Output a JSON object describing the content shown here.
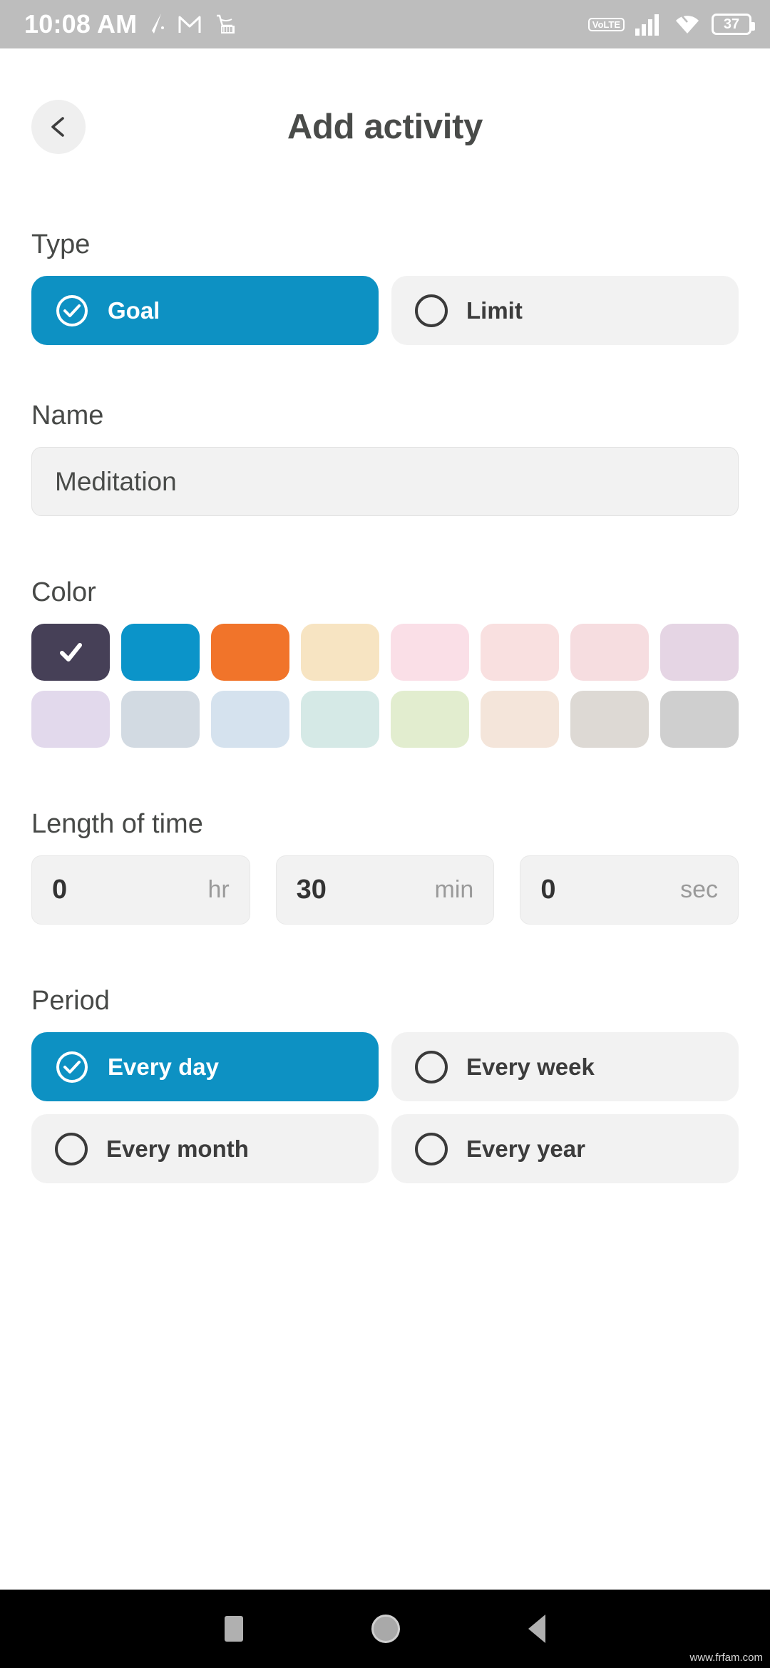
{
  "status_bar": {
    "time": "10:08 AM",
    "notification_icons": [
      "pen-slash-icon",
      "gmail-icon",
      "amazon-cart-icon"
    ],
    "network_label_top": "Vo",
    "network_label_bottom": "LTE",
    "battery_level": "37",
    "right_icons": [
      "volte-icon",
      "signal-bars-icon",
      "wifi-icon",
      "battery-icon"
    ]
  },
  "header": {
    "back_icon": "arrow-left-icon",
    "title": "Add activity"
  },
  "type_section": {
    "label": "Type",
    "options": [
      {
        "label": "Goal",
        "selected": true,
        "icon": "check-circle-icon"
      },
      {
        "label": "Limit",
        "selected": false,
        "icon": "circle-outline-icon"
      }
    ]
  },
  "name_section": {
    "label": "Name",
    "value": "Meditation",
    "placeholder": "Name"
  },
  "color_section": {
    "label": "Color",
    "selected_index": 0,
    "check_icon": "check-icon",
    "swatches": [
      "#464057",
      "#0b94c9",
      "#f1742a",
      "#f7e4c2",
      "#fadfe7",
      "#f9e0e0",
      "#f6dde0",
      "#e5d5e4",
      "#e2d9ec",
      "#d2dae2",
      "#d5e2ee",
      "#d5e9e6",
      "#e2edcf",
      "#f4e5da",
      "#ddd9d4",
      "#cfcfcf"
    ]
  },
  "length_section": {
    "label": "Length of time",
    "fields": [
      {
        "value": "0",
        "unit": "hr"
      },
      {
        "value": "30",
        "unit": "min"
      },
      {
        "value": "0",
        "unit": "sec"
      }
    ]
  },
  "period_section": {
    "label": "Period",
    "options": [
      {
        "label": "Every day",
        "selected": true
      },
      {
        "label": "Every week",
        "selected": false
      },
      {
        "label": "Every month",
        "selected": false
      },
      {
        "label": "Every year",
        "selected": false
      }
    ]
  },
  "nav_bar": {
    "recents_label": "recents",
    "home_label": "home",
    "back_label": "back"
  },
  "watermark": "www.frfam.com",
  "colors": {
    "accent": "#0d91c3",
    "status_bar_bg": "#bdbdbd",
    "chip_bg": "#f2f2f2",
    "text_dark": "#474947"
  }
}
